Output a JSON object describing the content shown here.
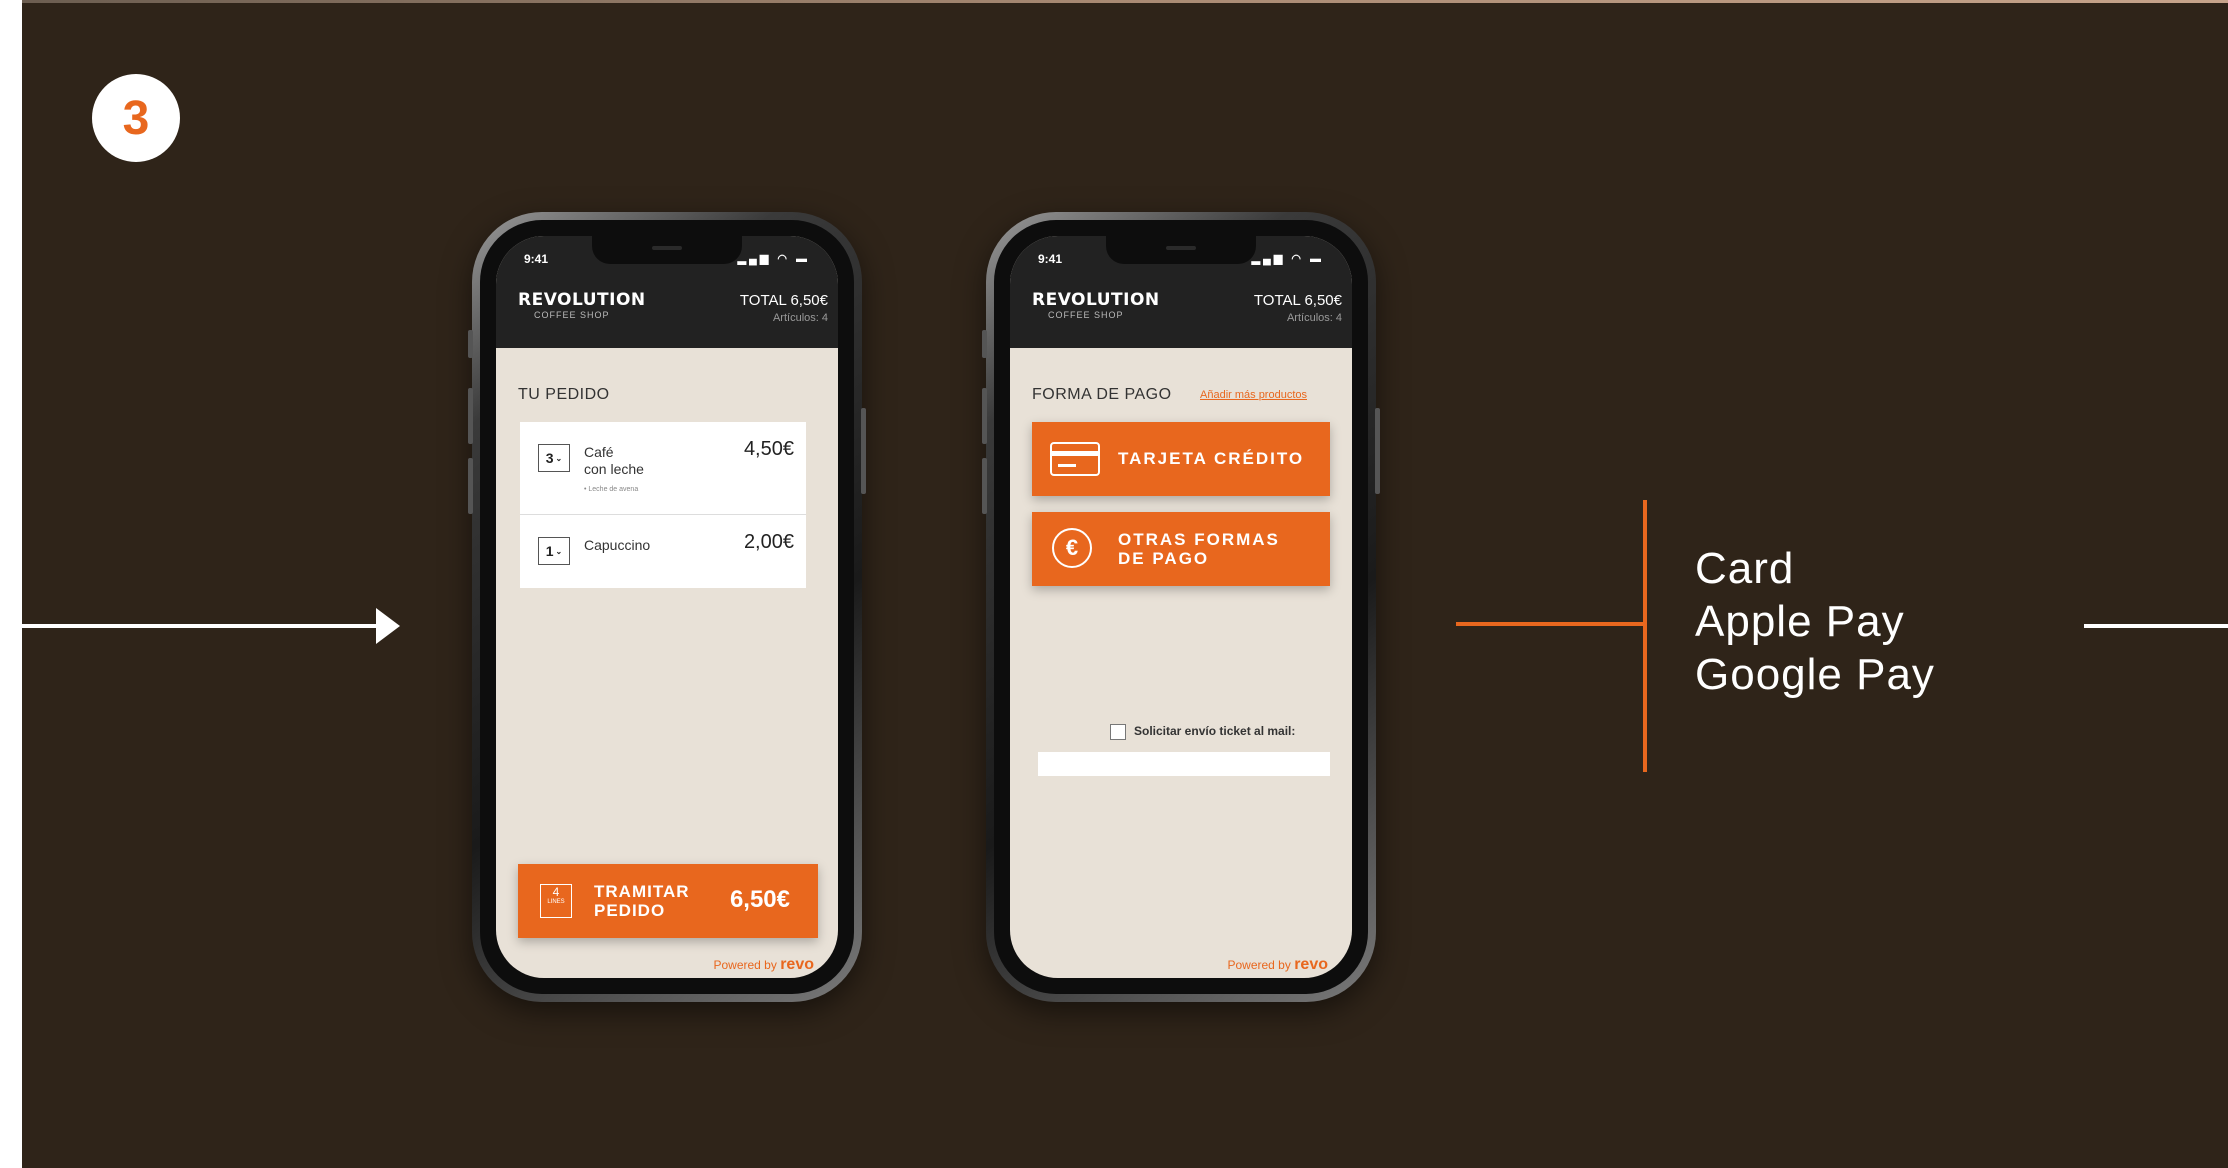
{
  "step": {
    "number": "3"
  },
  "colors": {
    "background": "#2f2419",
    "accent": "#e8671e",
    "screen": "#e8e1d7"
  },
  "phone_left": {
    "status": {
      "time": "9:41",
      "icons": "signal-wifi-battery"
    },
    "brand": {
      "name": "REVOLUTION",
      "sub": "COFFEE SHOP"
    },
    "header": {
      "total": "TOTAL 6,50€",
      "articulos": "Artículos: 4"
    },
    "section_title": "TU PEDIDO",
    "items": [
      {
        "qty": "3",
        "name_line1": "Café",
        "name_line2": "con leche",
        "note": "• Leche de avena",
        "price": "4,50€"
      },
      {
        "qty": "1",
        "name_line1": "Capuccino",
        "name_line2": "",
        "note": "",
        "price": "2,00€"
      }
    ],
    "checkout": {
      "count": "4",
      "count_label": "LINES",
      "label_line1": "TRAMITAR",
      "label_line2": "PEDIDO",
      "price": "6,50€"
    },
    "powered": {
      "prefix": "Powered by",
      "brand": "revo"
    }
  },
  "phone_right": {
    "status": {
      "time": "9:41",
      "icons": "signal-wifi-battery"
    },
    "brand": {
      "name": "REVOLUTION",
      "sub": "COFFEE SHOP"
    },
    "header": {
      "total": "TOTAL 6,50€",
      "articulos": "Artículos: 4"
    },
    "section_title": "FORMA DE PAGO",
    "add_link": "Añadir más productos",
    "pay_card": "TARJETA CRÉDITO",
    "pay_other_line1": "OTRAS FORMAS",
    "pay_other_line2": "DE PAGO",
    "euro_symbol": "€",
    "ticket_label": "Solicitar envío ticket al mail:",
    "email_placeholder": "",
    "powered": {
      "prefix": "Powered by",
      "brand": "revo"
    }
  },
  "payment_methods": [
    "Card",
    "Apple Pay",
    "Google Pay"
  ]
}
